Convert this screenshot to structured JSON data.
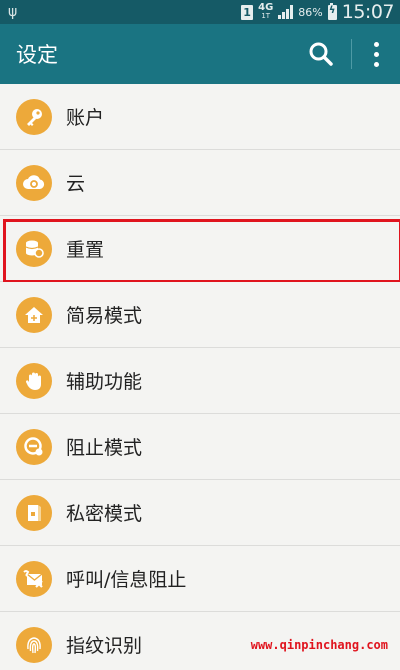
{
  "status_bar": {
    "usb_icon": "usb-icon",
    "sim": "1",
    "network": "4G",
    "network_sub": "1T",
    "battery_percent": "86%",
    "time": "15:07"
  },
  "action_bar": {
    "title": "设定",
    "search_icon": "search-icon",
    "more_icon": "more-vert-icon"
  },
  "settings": {
    "items": [
      {
        "label": "账户",
        "icon": "key-icon"
      },
      {
        "label": "云",
        "icon": "cloud-icon"
      },
      {
        "label": "重置",
        "icon": "backup-reset-icon",
        "highlighted": true
      },
      {
        "label": "简易模式",
        "icon": "home-easy-mode-icon"
      },
      {
        "label": "辅助功能",
        "icon": "hand-icon"
      },
      {
        "label": "阻止模式",
        "icon": "block-mode-icon"
      },
      {
        "label": "私密模式",
        "icon": "private-mode-icon"
      },
      {
        "label": "呼叫/信息阻止",
        "icon": "call-block-icon"
      },
      {
        "label": "指纹识别",
        "icon": "fingerprint-icon"
      }
    ]
  },
  "colors": {
    "status_bar": "#155a66",
    "action_bar": "#1a7482",
    "icon_bg": "#eda93a",
    "highlight": "#e0141e",
    "background": "#f4f4f2"
  },
  "watermark": "www.qinpinchang.com"
}
